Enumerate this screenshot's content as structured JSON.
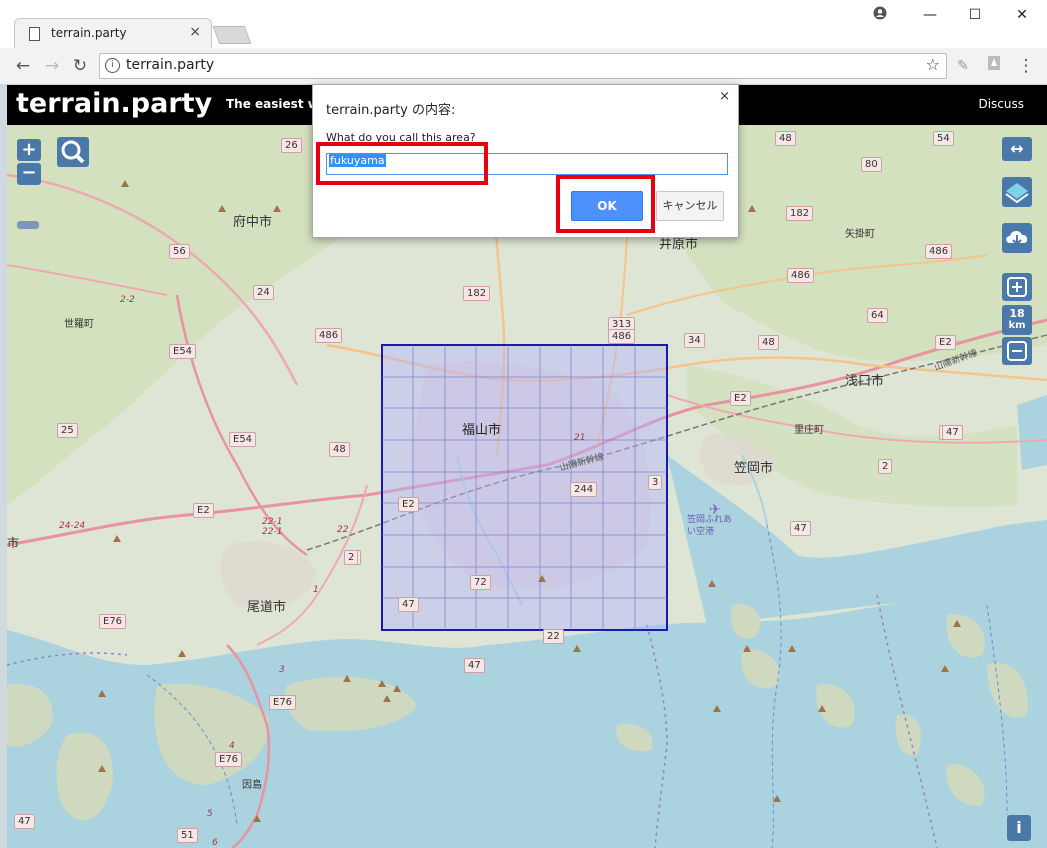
{
  "browser": {
    "tab_title": "terrain.party",
    "tab_close": "×",
    "url": "terrain.party",
    "window_controls": {
      "minimize": "—",
      "maximize": "☐",
      "close": "✕"
    }
  },
  "site": {
    "title": "terrain.party",
    "tagline": "The easiest way",
    "discuss_label": "Discuss"
  },
  "dialog": {
    "title": "terrain.party の内容:",
    "close": "×",
    "message": "What do you call this area?",
    "input_value": "fukuyama",
    "ok_label": "OK",
    "cancel_label": "キャンセル"
  },
  "map_controls": {
    "zoom_in": "+",
    "zoom_out": "−",
    "box_size_value": "18",
    "box_size_unit": "km",
    "info": "i"
  },
  "map_labels": {
    "cities": [
      "府中市",
      "井原市",
      "世羅町",
      "矢掛町",
      "福山市",
      "浅口市",
      "里庄町",
      "笠岡市",
      "尾道市",
      "因島",
      "市"
    ],
    "airport": "笠岡ふれあい空港",
    "shinkansen": "山陽新幹線",
    "route_shields": [
      "26",
      "56",
      "24",
      "486",
      "E54",
      "182",
      "313",
      "486",
      "34",
      "48",
      "64",
      "E2",
      "48",
      "80",
      "54",
      "486",
      "182",
      "486",
      "E2",
      "25",
      "E54",
      "48",
      "E2",
      "E2",
      "2",
      "244",
      "3",
      "E2",
      "2",
      "72",
      "47",
      "22",
      "47",
      "2",
      "E76",
      "E76",
      "E76",
      "51",
      "47",
      "47",
      "47",
      "2"
    ],
    "road_numbers": [
      "2-2",
      "24-24",
      "22-1",
      "22-1",
      "22",
      "21",
      "1",
      "3",
      "4",
      "5",
      "6"
    ]
  },
  "colors": {
    "header_bg": "#000000",
    "selection_fill": "#b4b4ff",
    "selection_stroke": "#1a1aa8",
    "highlight_red": "#e8000f",
    "ok_blue": "#4d90fe",
    "control_blue": "#4a78a8",
    "water": "#aad3df",
    "land": "#dfe5d4"
  },
  "icons": [
    "page-icon",
    "back-icon",
    "forward-icon",
    "reload-icon",
    "info-icon",
    "star-icon",
    "extension-icon",
    "pdf-icon",
    "menu-icon",
    "account-icon",
    "search-icon",
    "expand-icon",
    "layers-icon",
    "download-icon",
    "plus-icon",
    "minus-icon",
    "info-icon"
  ]
}
